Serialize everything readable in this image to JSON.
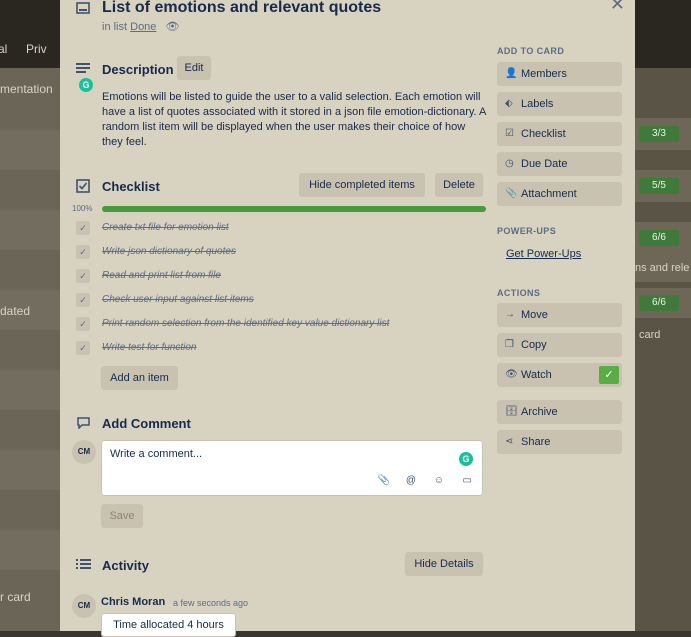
{
  "background": {
    "left_fragments": [
      "al",
      "Priv",
      "mentation",
      "dated",
      "r card"
    ],
    "right_fragments": [
      "3/3",
      "5/5",
      "6/6",
      "ns and rele",
      "6/6",
      "card"
    ]
  },
  "card": {
    "title": "List of emotions and relevant quotes",
    "in_list_prefix": "in list",
    "list_name": "Done"
  },
  "description": {
    "heading": "Description",
    "edit_label": "Edit",
    "text": "Emotions will be listed to guide the user to a valid selection. Each emotion will have a list of quotes associated with it stored in a json file emotion-dictionary. A random list item will be displayed when the user makes their choice of how they feel."
  },
  "checklist": {
    "heading": "Checklist",
    "hide_completed_label": "Hide completed items",
    "delete_label": "Delete",
    "progress_label": "100%",
    "progress": 1.0,
    "items": [
      "Create txt file for emotion list",
      "Write json dictionary of quotes",
      "Read and print list from file",
      "Check user input against list items",
      "Print random selection from the identified key value dictionary list",
      "Write test for function"
    ],
    "add_item_label": "Add an item"
  },
  "comment": {
    "heading": "Add Comment",
    "avatar_initials": "CM",
    "placeholder": "Write a comment...",
    "save_label": "Save"
  },
  "activity": {
    "heading": "Activity",
    "hide_details_label": "Hide Details",
    "avatar_initials": "CM",
    "user": "Chris Moran",
    "time": "a few seconds ago",
    "entry_text": "Time allocated 4 hours"
  },
  "sidebar": {
    "add_to_card_heading": "ADD TO CARD",
    "add_to_card": [
      "Members",
      "Labels",
      "Checklist",
      "Due Date",
      "Attachment"
    ],
    "power_ups_heading": "POWER-UPS",
    "power_ups_link": "Get Power-Ups",
    "actions_heading": "ACTIONS",
    "actions": [
      "Move",
      "Copy",
      "Watch",
      "Archive",
      "Share"
    ]
  },
  "colors": {
    "modal_bg": "#d8d2c1",
    "progress_green": "#4a9a3e",
    "watch_green": "#5aac44",
    "grammarly_green": "#15c39a"
  }
}
